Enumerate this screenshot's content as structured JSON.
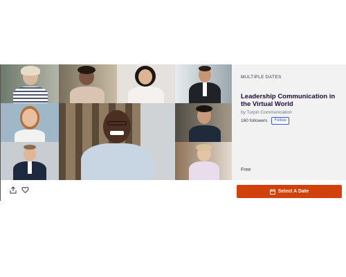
{
  "event": {
    "eyebrow": "MULTIPLE DATES",
    "title": "Leadership Communication in the Virtual World",
    "organizer": "by Turpin Communication",
    "followers": "160 followers",
    "follow_label": "Follow",
    "price": "Free"
  },
  "actions": {
    "cta_label": "Select A Date",
    "share_icon": "share-icon",
    "like_icon": "heart-icon"
  },
  "colors": {
    "cta": "#d1410c",
    "follow": "#3659e3",
    "panel": "#f2f2f2"
  }
}
